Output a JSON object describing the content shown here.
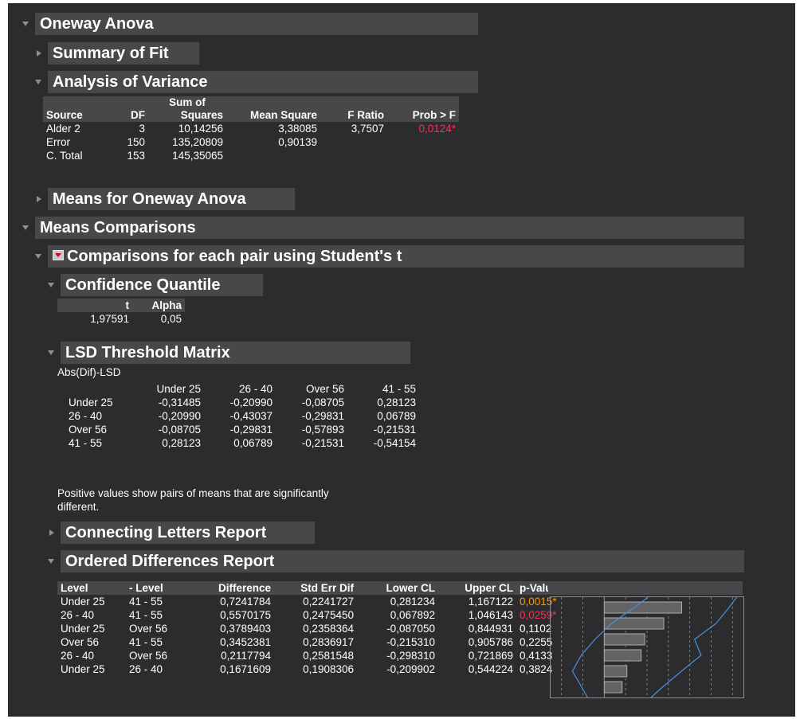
{
  "oneway": {
    "title": "Oneway Anova"
  },
  "summary_fit": {
    "title": "Summary of Fit"
  },
  "anova": {
    "title": "Analysis of Variance",
    "head_top": {
      "sum": "Sum of"
    },
    "headers": [
      "Source",
      "DF",
      "Squares",
      "Mean Square",
      "F Ratio",
      "Prob > F"
    ],
    "rows": [
      [
        "Alder 2",
        "3",
        "10,14256",
        "3,38085",
        "3,7507",
        "0,0124*"
      ],
      [
        "Error",
        "150",
        "135,20809",
        "0,90139",
        "",
        ""
      ],
      [
        "C. Total",
        "153",
        "145,35065",
        "",
        "",
        ""
      ]
    ]
  },
  "means_oneway": {
    "title": "Means for Oneway Anova"
  },
  "means_comp": {
    "title": "Means Comparisons"
  },
  "students": {
    "title": "Comparisons for each pair using Student's t"
  },
  "conf_quant": {
    "title": "Confidence Quantile",
    "headers": [
      "t",
      "Alpha"
    ],
    "values": [
      "1,97591",
      "0,05"
    ]
  },
  "lsd": {
    "title": "LSD Threshold Matrix",
    "label": "Abs(Dif)-LSD",
    "cols": [
      "Under 25",
      "26 - 40",
      "Over 56",
      "41 - 55"
    ],
    "rows": [
      {
        "name": "Under 25",
        "vals": [
          "-0,31485",
          "-0,20990",
          "-0,08705",
          "0,28123"
        ]
      },
      {
        "name": "26 - 40",
        "vals": [
          "-0,20990",
          "-0,43037",
          "-0,29831",
          "0,06789"
        ]
      },
      {
        "name": "Over 56",
        "vals": [
          "-0,08705",
          "-0,29831",
          "-0,57893",
          "-0,21531"
        ]
      },
      {
        "name": "41 - 55",
        "vals": [
          "0,28123",
          "0,06789",
          "-0,21531",
          "-0,54154"
        ]
      }
    ],
    "note_1": "Positive values show pairs of means that are significantly",
    "note_2": "different."
  },
  "connecting": {
    "title": "Connecting Letters Report"
  },
  "ordered": {
    "title": "Ordered Differences Report",
    "headers": [
      "Level",
      "- Level",
      "Difference",
      "Std Err Dif",
      "Lower CL",
      "Upper CL",
      "p-Value"
    ],
    "rows": [
      [
        "Under 25",
        "41 - 55",
        "0,7241784",
        "0,2241727",
        "0,281234",
        "1,167122",
        "0,0015*"
      ],
      [
        "26 - 40",
        "41 - 55",
        "0,5570175",
        "0,2475450",
        "0,067892",
        "1,046143",
        "0,0259*"
      ],
      [
        "Under 25",
        "Over 56",
        "0,3789403",
        "0,2358364",
        "-0,087050",
        "0,844931",
        "0,1102"
      ],
      [
        "Over 56",
        "41 - 55",
        "0,3452381",
        "0,2836917",
        "-0,215310",
        "0,905786",
        "0,2255"
      ],
      [
        "26 - 40",
        "Over 56",
        "0,2117794",
        "0,2581548",
        "-0,298310",
        "0,721869",
        "0,4133"
      ],
      [
        "Under 25",
        "26 - 40",
        "0,1671609",
        "0,1908306",
        "-0,209902",
        "0,544224",
        "0,3824"
      ]
    ],
    "pvalue_colors": [
      "#ff9500",
      "#ff2d55",
      "",
      "",
      "",
      ""
    ]
  },
  "colors": {
    "background": "#2c2c2e",
    "header_bar": "#48484a",
    "curve": "#4a90e2",
    "bar_fill": "#636366"
  }
}
